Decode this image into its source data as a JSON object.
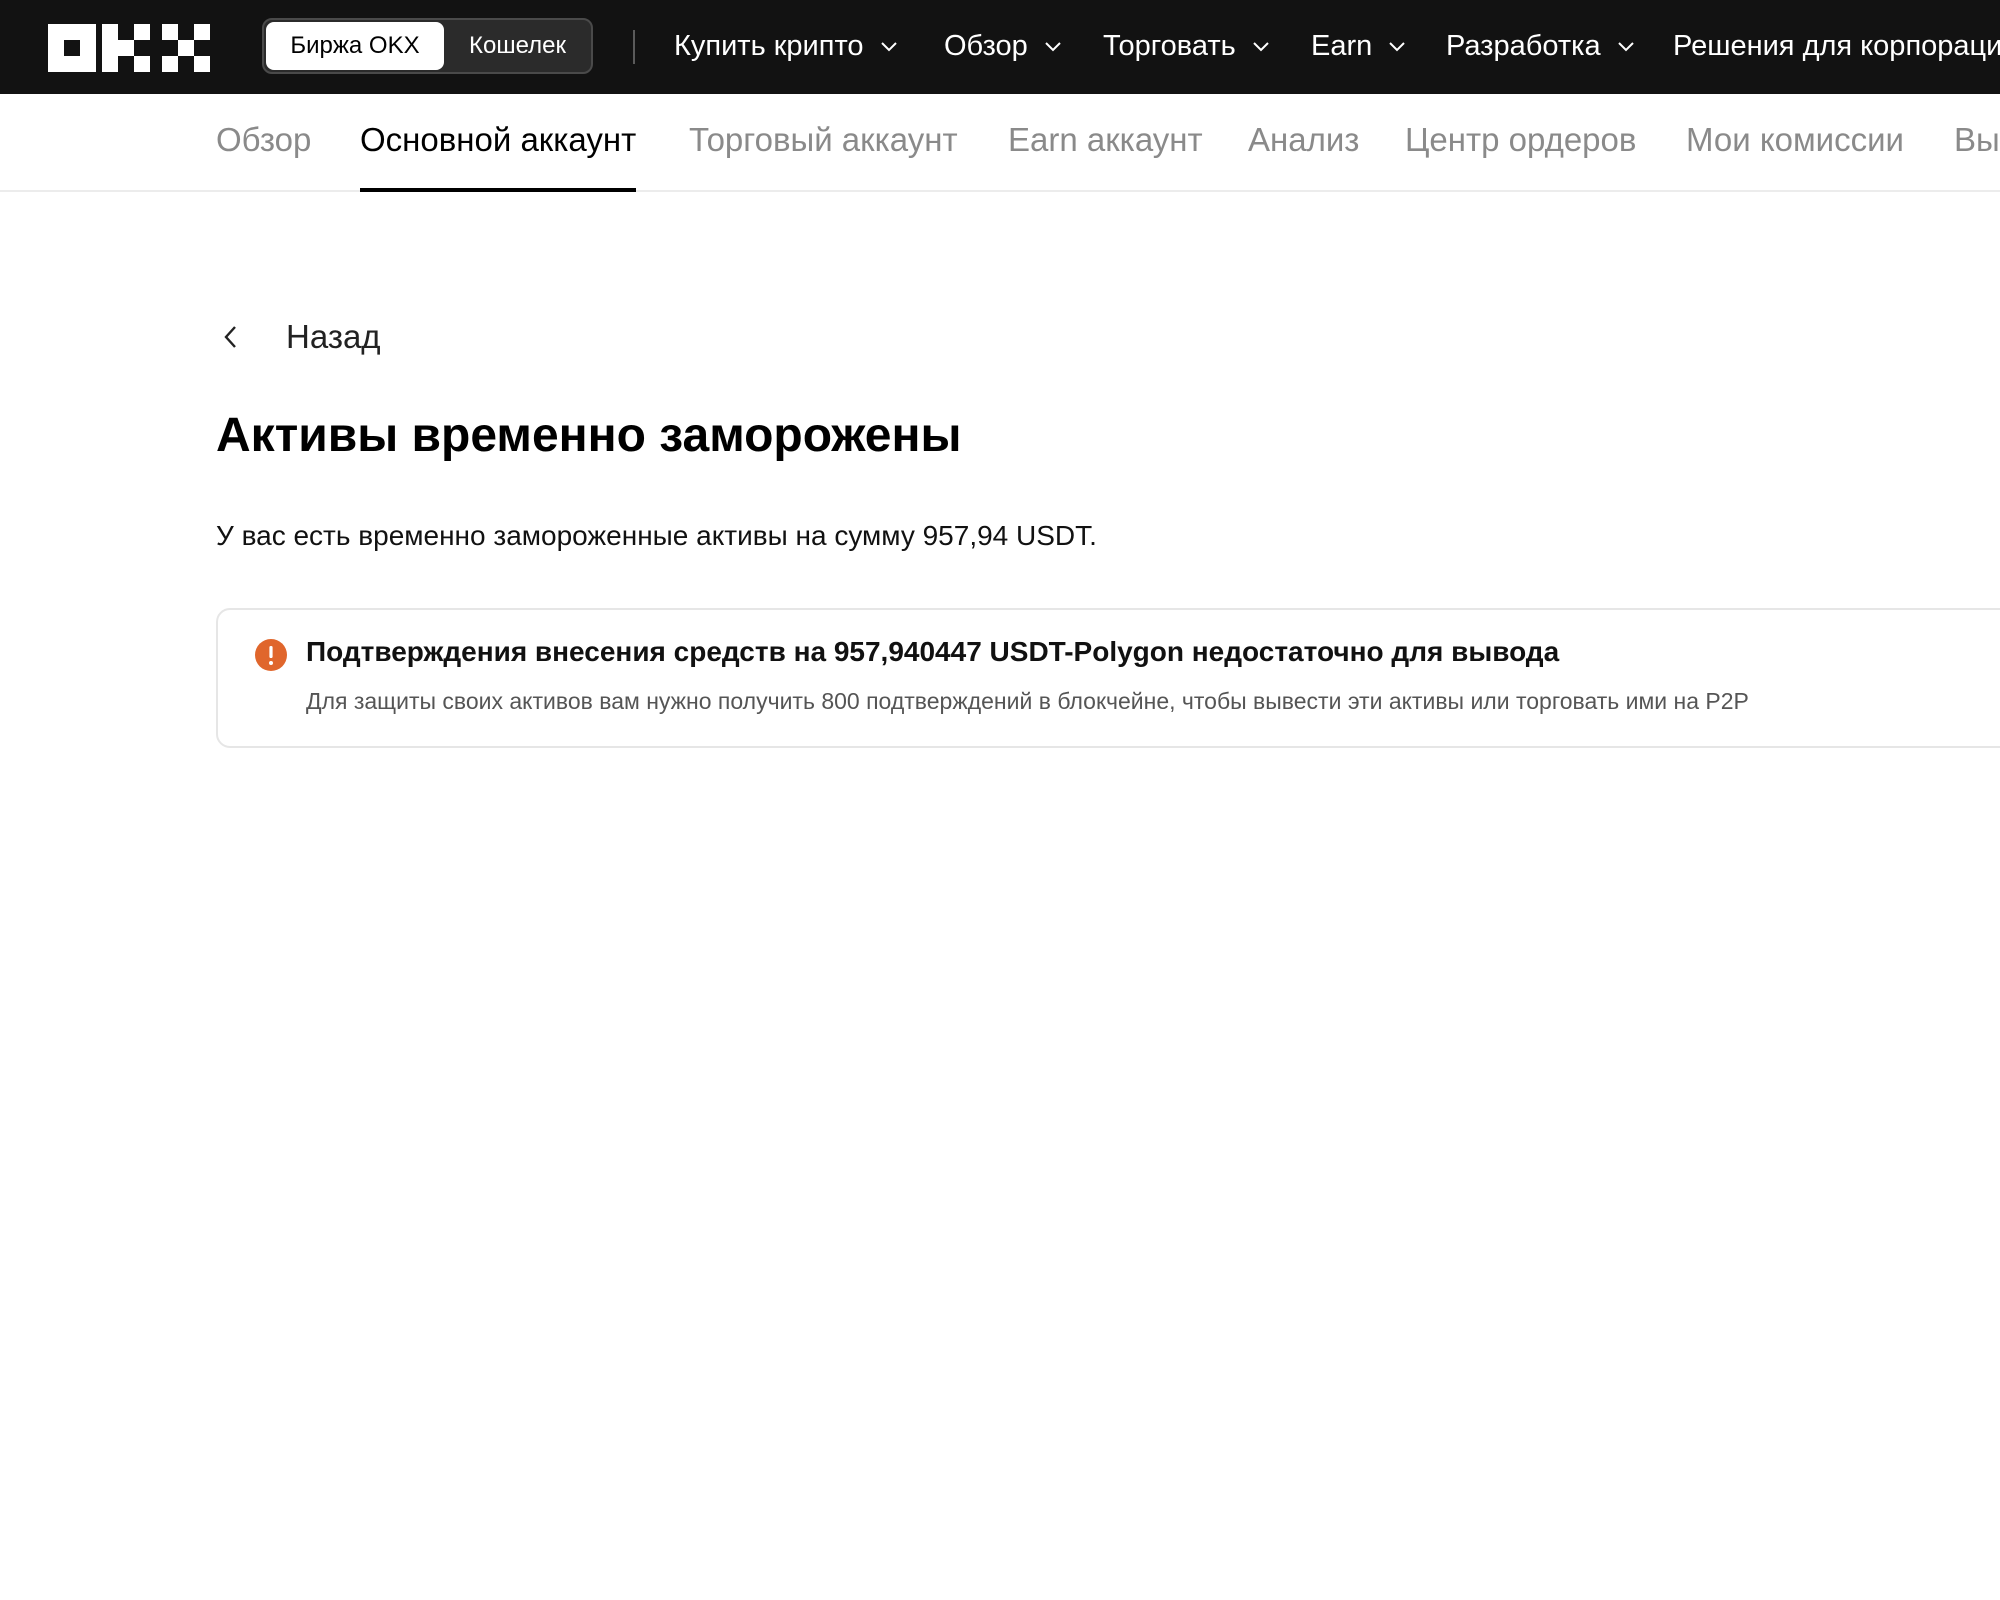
{
  "header": {
    "logo_alt": "OKX",
    "switch": {
      "exchange_label": "Биржа OKX",
      "wallet_label": "Кошелек"
    },
    "nav": [
      {
        "label": "Купить крипто"
      },
      {
        "label": "Обзор"
      },
      {
        "label": "Торговать"
      },
      {
        "label": "Earn"
      },
      {
        "label": "Разработка"
      },
      {
        "label": "Решения для корпораци"
      }
    ]
  },
  "tabs": [
    {
      "label": "Обзор",
      "active": false
    },
    {
      "label": "Основной аккаунт",
      "active": true
    },
    {
      "label": "Торговый аккаунт",
      "active": false
    },
    {
      "label": "Earn аккаунт",
      "active": false
    },
    {
      "label": "Анализ",
      "active": false
    },
    {
      "label": "Центр ордеров",
      "active": false
    },
    {
      "label": "Мои комиссии",
      "active": false
    },
    {
      "label": "Вы",
      "active": false
    }
  ],
  "main": {
    "back_label": "Назад",
    "title": "Активы временно заморожены",
    "summary": "У вас есть временно замороженные активы на сумму 957,94 USDT.",
    "notice": {
      "icon": "warning-icon",
      "icon_color": "#E0662C",
      "title": "Подтверждения внесения средств на 957,940447 USDT-Polygon недостаточно для вывода",
      "description": "Для защиты своих активов вам нужно получить 800 подтверждений в блокчейне, чтобы вывести эти активы или торговать ими на P2P"
    }
  },
  "colors": {
    "topbar_bg": "#121212",
    "accent_warning": "#E0662C",
    "tab_inactive": "#8A8A8A"
  }
}
